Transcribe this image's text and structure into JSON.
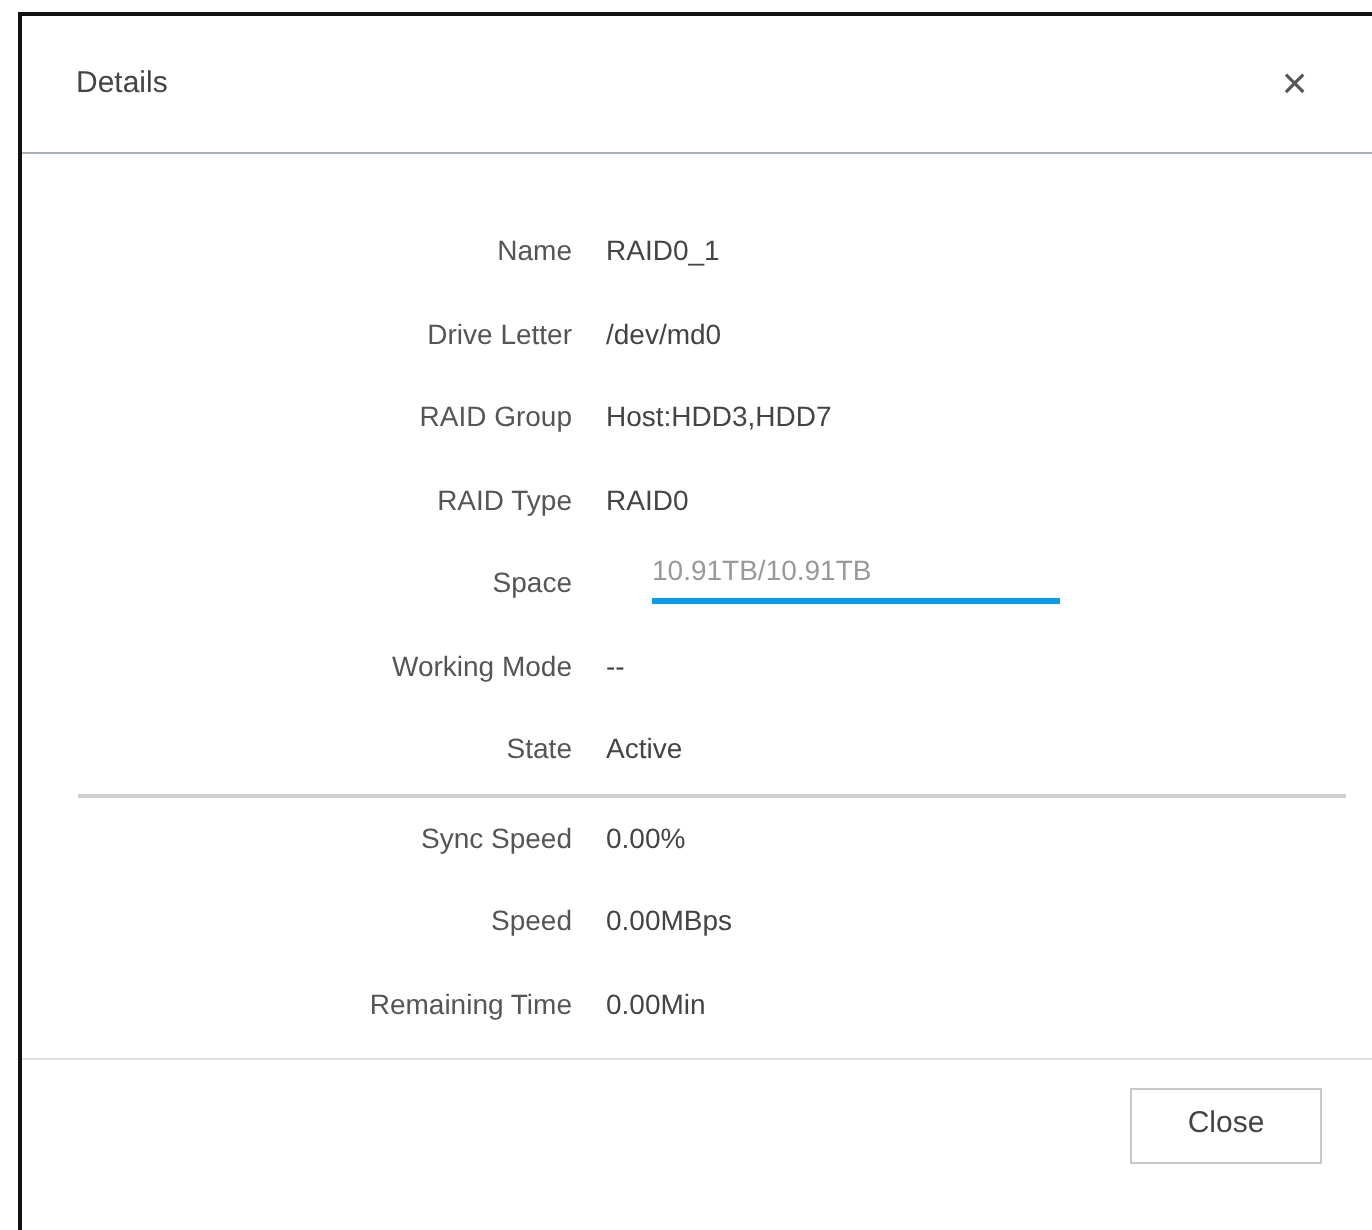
{
  "dialog": {
    "title": "Details",
    "close_icon": "×"
  },
  "details": [
    {
      "kind": "text",
      "label": "Name",
      "value": "RAID0_1"
    },
    {
      "kind": "text",
      "label": "Drive Letter",
      "value": "/dev/md0"
    },
    {
      "kind": "text",
      "label": "RAID Group",
      "value": "Host:HDD3,HDD7"
    },
    {
      "kind": "text",
      "label": "RAID Type",
      "value": "RAID0"
    },
    {
      "kind": "field",
      "label": "Space",
      "value": "10.91TB/10.91TB",
      "disabled": true,
      "focused": true
    },
    {
      "kind": "text",
      "label": "Working Mode",
      "value": "--"
    },
    {
      "kind": "text",
      "label": "State",
      "value": "Active"
    }
  ],
  "sync": [
    {
      "label": "Sync Speed",
      "value": "0.00%"
    },
    {
      "label": "Speed",
      "value": "0.00MBps"
    },
    {
      "label": "Remaining Time",
      "value": "0.00Min"
    }
  ],
  "buttons": [
    "Close"
  ]
}
